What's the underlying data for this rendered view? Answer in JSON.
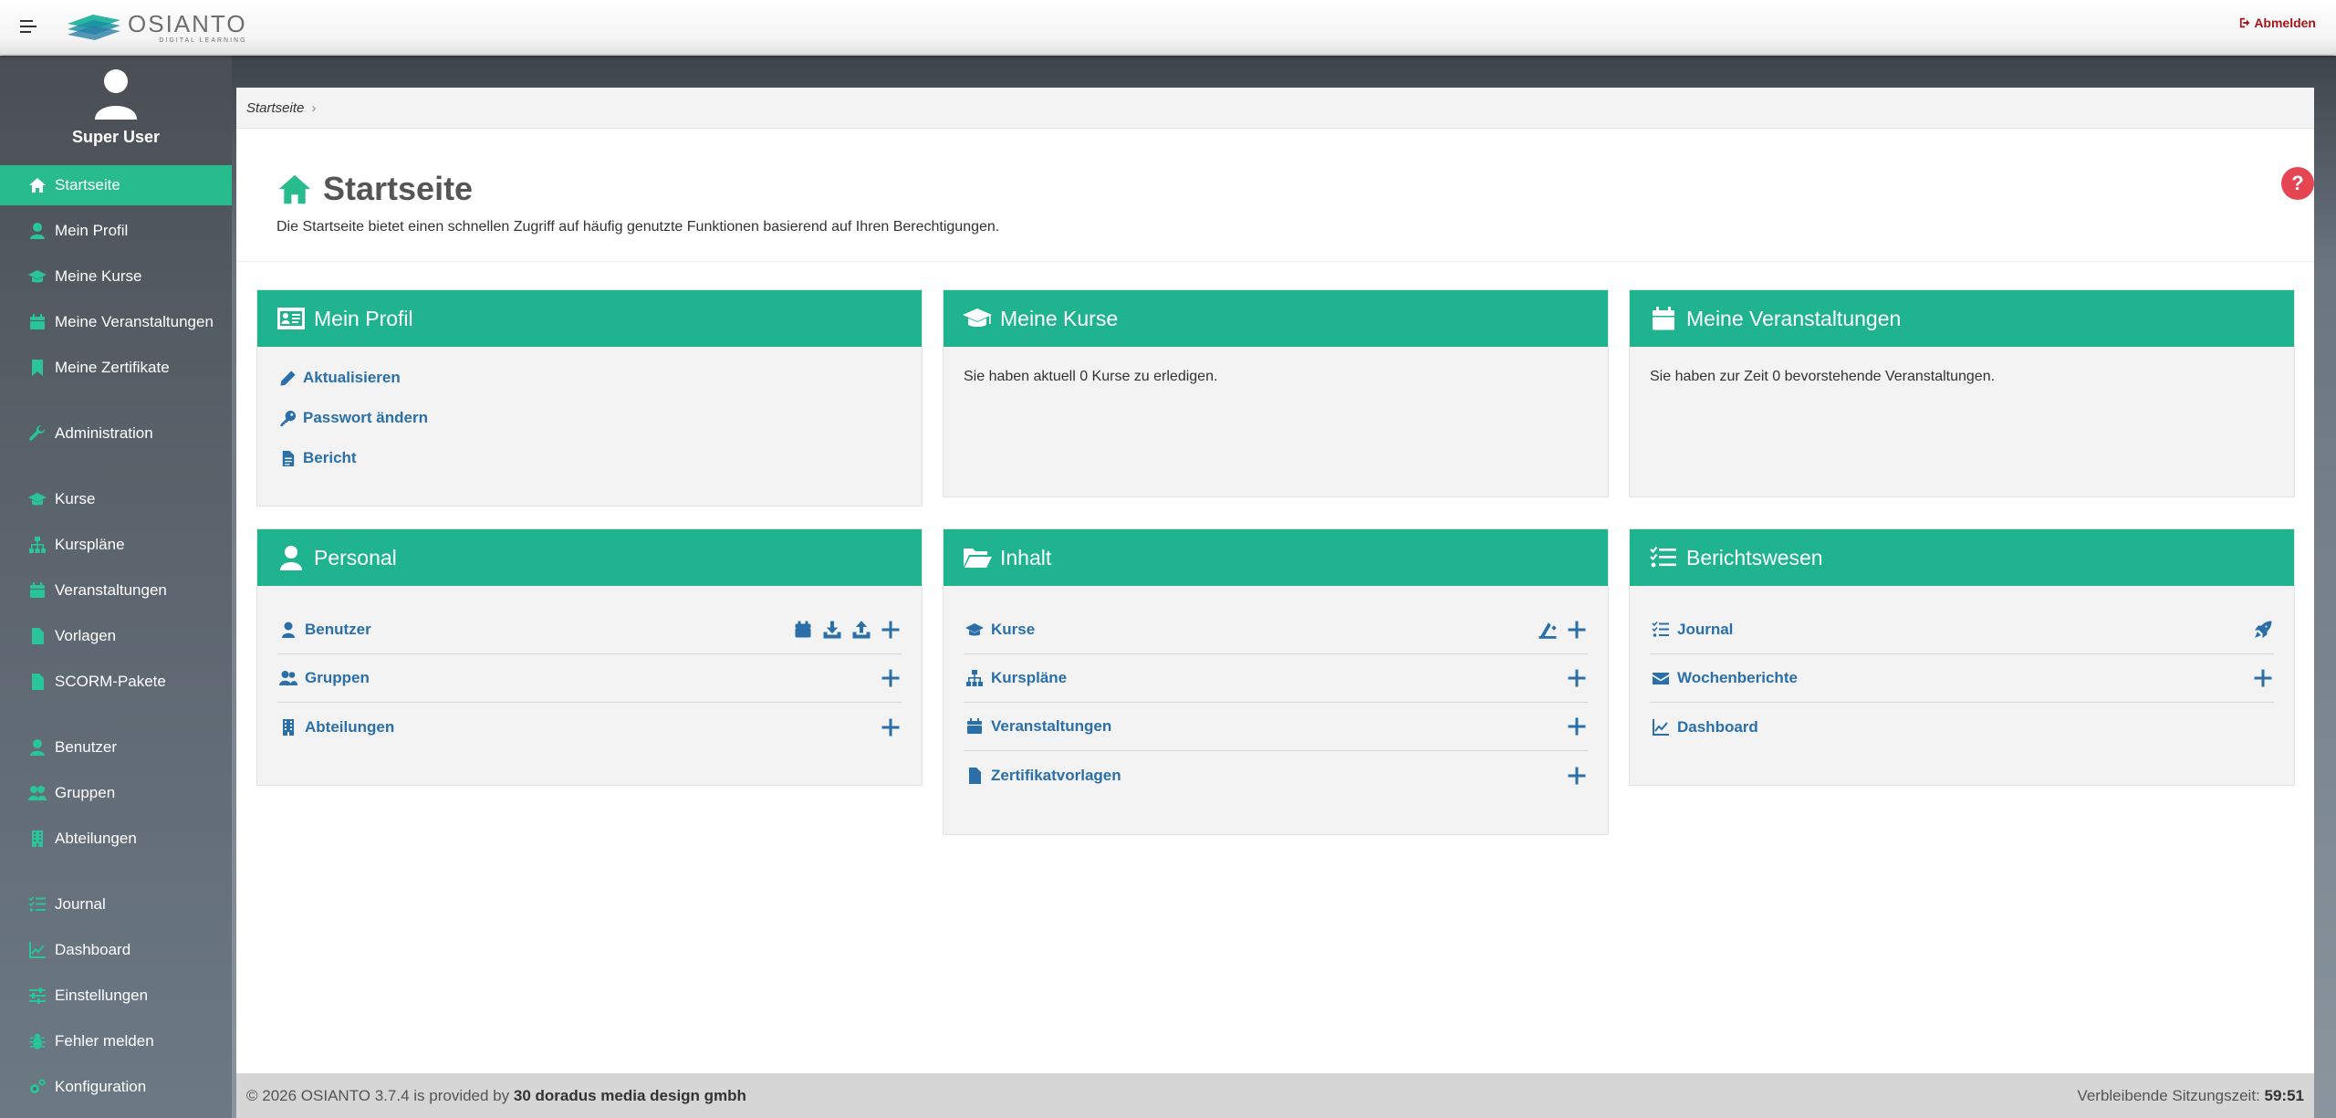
{
  "app": {
    "logo_name": "OSIANTO",
    "logo_sub": "DIGITAL LEARNING",
    "logout_label": "Abmelden"
  },
  "user": {
    "name": "Super User"
  },
  "sidebar": {
    "items": [
      {
        "label": "Startseite",
        "icon": "home-icon",
        "active": true
      },
      {
        "label": "Mein Profil",
        "icon": "user-icon"
      },
      {
        "label": "Meine Kurse",
        "icon": "graduation-cap-icon"
      },
      {
        "label": "Meine Veranstaltungen",
        "icon": "calendar-icon"
      },
      {
        "label": "Meine Zertifikate",
        "icon": "bookmark-icon"
      },
      {
        "label": "Administration",
        "icon": "wrench-icon"
      },
      {
        "label": "Kurse",
        "icon": "graduation-cap-icon"
      },
      {
        "label": "Kurspläne",
        "icon": "sitemap-icon"
      },
      {
        "label": "Veranstaltungen",
        "icon": "calendar-icon"
      },
      {
        "label": "Vorlagen",
        "icon": "file-icon"
      },
      {
        "label": "SCORM-Pakete",
        "icon": "file-alt-icon"
      },
      {
        "label": "Benutzer",
        "icon": "user-icon"
      },
      {
        "label": "Gruppen",
        "icon": "users-icon"
      },
      {
        "label": "Abteilungen",
        "icon": "building-icon"
      },
      {
        "label": "Journal",
        "icon": "tasks-icon"
      },
      {
        "label": "Dashboard",
        "icon": "chart-line-icon"
      },
      {
        "label": "Einstellungen",
        "icon": "sliders-icon"
      },
      {
        "label": "Fehler melden",
        "icon": "bug-icon"
      },
      {
        "label": "Konfiguration",
        "icon": "cogs-icon"
      }
    ]
  },
  "breadcrumb": {
    "current": "Startseite",
    "separator": "›"
  },
  "page": {
    "title": "Startseite",
    "description": "Die Startseite bietet einen schnellen Zugriff auf häufig genutzte Funktionen basierend auf Ihren Berechtigungen.",
    "help": "?"
  },
  "cards": {
    "mein_profil": {
      "title": "Mein Profil",
      "links": [
        "Aktualisieren",
        "Passwort ändern",
        "Bericht"
      ]
    },
    "meine_kurse": {
      "title": "Meine Kurse",
      "text": "Sie haben aktuell 0 Kurse zu erledigen."
    },
    "meine_veranstaltungen": {
      "title": "Meine Veranstaltungen",
      "text": "Sie haben zur Zeit 0 bevorstehende Veranstaltungen."
    },
    "personal": {
      "title": "Personal",
      "rows": [
        "Benutzer",
        "Gruppen",
        "Abteilungen"
      ]
    },
    "inhalt": {
      "title": "Inhalt",
      "rows": [
        "Kurse",
        "Kurspläne",
        "Veranstaltungen",
        "Zertifikatvorlagen"
      ]
    },
    "berichtswesen": {
      "title": "Berichtswesen",
      "rows": [
        "Journal",
        "Wochenberichte",
        "Dashboard"
      ]
    }
  },
  "footer": {
    "copyright": "© 2026 OSIANTO 3.7.4 is provided by ",
    "company": "30 doradus media design gmbh",
    "session_label": "Verbleibende Sitzungszeit: ",
    "session_time": "59:51"
  },
  "colors": {
    "accent": "#28bb8c",
    "card_header": "#1fb38f",
    "link": "#2a6fa8",
    "logout": "#a3141b",
    "help": "#e64553"
  }
}
